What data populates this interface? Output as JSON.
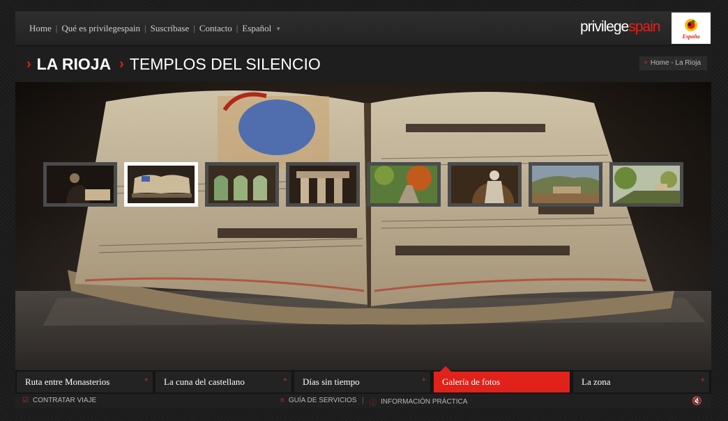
{
  "nav": {
    "items": [
      "Home",
      "Qué es privilegespain",
      "Suscríbase",
      "Contacto",
      "Español"
    ],
    "separator": "|",
    "language_caret_icon": "caret-down-icon"
  },
  "brand": {
    "name_main": "privilege",
    "name_accent": "spain",
    "accent_color": "#e0221b"
  },
  "logo": {
    "word": "España"
  },
  "header": {
    "region": "LA RIOJA",
    "place": "TEMPLOS DEL SILENCIO"
  },
  "breadcrumb": {
    "label": "Home - La Rioja"
  },
  "gallery": {
    "thumbnails": [
      "monk-reading",
      "open-choir-book",
      "arched-windows",
      "stone-columns",
      "autumn-path",
      "stone-saint-statue",
      "monastery-valley",
      "tree-lined-road"
    ],
    "active_index": 1
  },
  "tabs": [
    {
      "label": "Ruta entre Monasterios",
      "active": false
    },
    {
      "label": "La cuna del castellano",
      "active": false
    },
    {
      "label": "Días sin tiempo",
      "active": false
    },
    {
      "label": "Galería de fotos",
      "active": true
    },
    {
      "label": "La zona",
      "active": false
    }
  ],
  "footer": {
    "contract": "CONTRATAR VIAJE",
    "services": "GUÍA DE SERVICIOS",
    "info": "INFORMACIÓN PRÁCTICA",
    "separator": "|"
  },
  "colors": {
    "accent": "#e0221b",
    "background": "#1a1a1a"
  }
}
